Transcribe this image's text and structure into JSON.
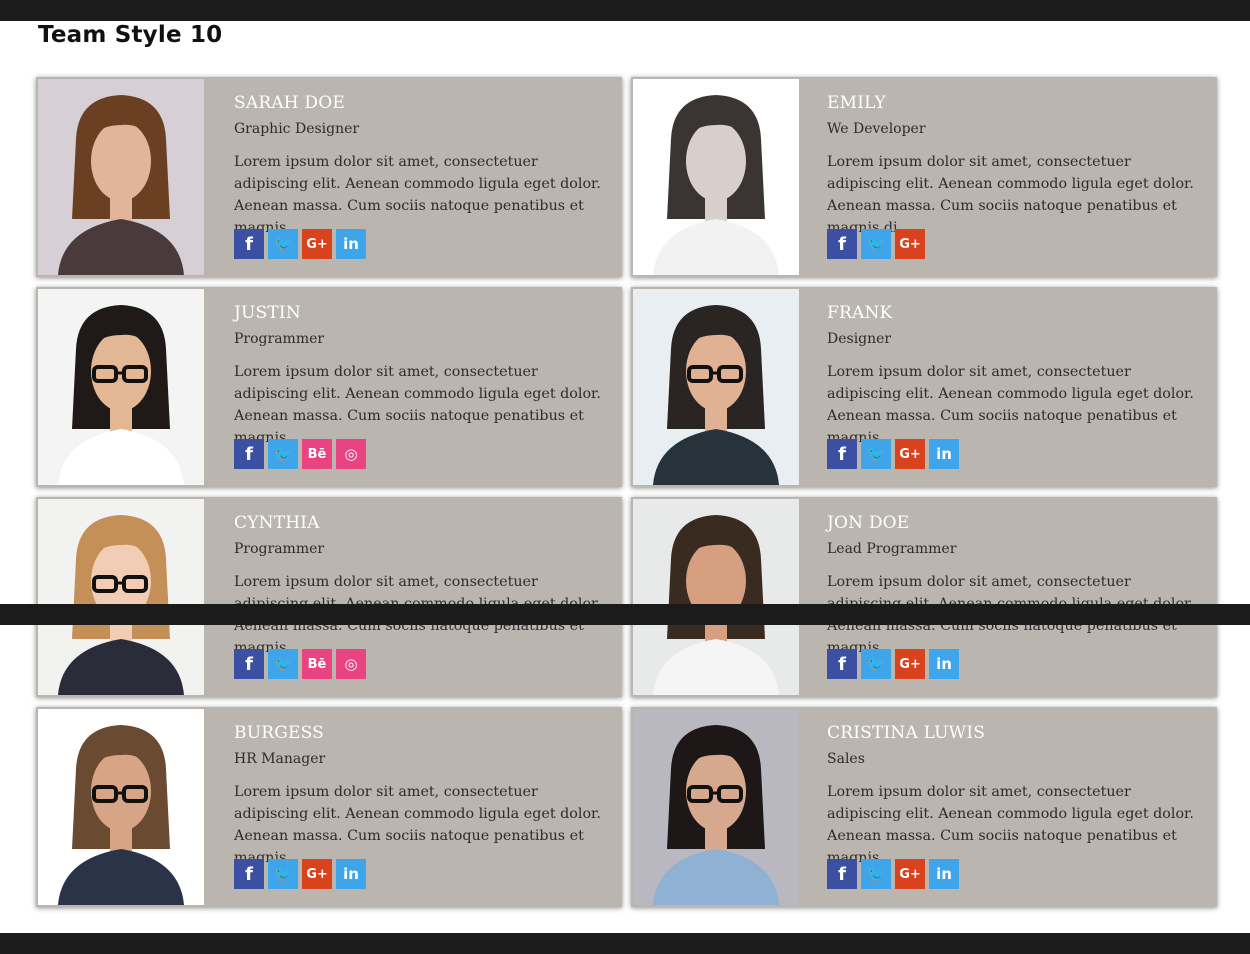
{
  "page_title": "Team Style 10",
  "members": [
    {
      "name": "SARAH DOE",
      "role": "Graphic Designer",
      "bio": "Lorem ipsum dolor sit amet, consectetuer adipiscing elit. Aenean commodo ligula eget dolor. Aenean massa. Cum sociis natoque penatibus et magnis",
      "social": [
        "facebook-icon",
        "twitter-icon",
        "google-plus-icon",
        "linkedin-icon"
      ]
    },
    {
      "name": "EMILY",
      "role": "We Developer",
      "bio": "Lorem ipsum dolor sit amet, consectetuer adipiscing elit. Aenean commodo ligula eget dolor. Aenean massa. Cum sociis natoque penatibus et magnis di",
      "social": [
        "facebook-icon",
        "twitter-icon",
        "google-plus-icon"
      ]
    },
    {
      "name": "JUSTIN",
      "role": "Programmer",
      "bio": "Lorem ipsum dolor sit amet, consectetuer adipiscing elit. Aenean commodo ligula eget dolor. Aenean massa. Cum sociis natoque penatibus et magnis",
      "social": [
        "facebook-icon",
        "twitter-icon",
        "behance-icon",
        "dribbble-icon"
      ]
    },
    {
      "name": "FRANK",
      "role": "Designer",
      "bio": "Lorem ipsum dolor sit amet, consectetuer adipiscing elit. Aenean commodo ligula eget dolor. Aenean massa. Cum sociis natoque penatibus et magnis",
      "social": [
        "facebook-icon",
        "twitter-icon",
        "google-plus-icon",
        "linkedin-icon"
      ]
    },
    {
      "name": "CYNTHIA",
      "role": "Programmer",
      "bio": "Lorem ipsum dolor sit amet, consectetuer adipiscing elit. Aenean commodo ligula eget dolor. Aenean massa. Cum sociis natoque penatibus et magnis",
      "social": [
        "facebook-icon",
        "twitter-icon",
        "behance-icon",
        "dribbble-icon"
      ]
    },
    {
      "name": "JON DOE",
      "role": "Lead Programmer",
      "bio": "Lorem ipsum dolor sit amet, consectetuer adipiscing elit. Aenean commodo ligula eget dolor. Aenean massa. Cum sociis natoque penatibus et magnis",
      "social": [
        "facebook-icon",
        "twitter-icon",
        "google-plus-icon",
        "linkedin-icon"
      ]
    },
    {
      "name": "BURGESS",
      "role": "HR Manager",
      "bio": "Lorem ipsum dolor sit amet, consectetuer adipiscing elit. Aenean commodo ligula eget dolor. Aenean massa. Cum sociis natoque penatibus et magnis",
      "social": [
        "facebook-icon",
        "twitter-icon",
        "google-plus-icon",
        "linkedin-icon"
      ]
    },
    {
      "name": "CRISTINA LUWIS",
      "role": "Sales",
      "bio": "Lorem ipsum dolor sit amet, consectetuer adipiscing elit. Aenean commodo ligula eget dolor. Aenean massa. Cum sociis natoque penatibus et magnis",
      "social": [
        "facebook-icon",
        "twitter-icon",
        "google-plus-icon",
        "linkedin-icon"
      ]
    }
  ],
  "social_glyphs": {
    "facebook-icon": "f",
    "twitter-icon": "🐦",
    "google-plus-icon": "G+",
    "linkedin-icon": "in",
    "behance-icon": "Bē",
    "dribbble-icon": "◎"
  },
  "colors": {
    "card_bg": "#bab5ae",
    "facebook": "#3b4fa3",
    "twitter": "#3fa5ea",
    "google_plus": "#d8431e",
    "linkedin": "#3fa5ea",
    "behance": "#e94382",
    "dribbble": "#e94382"
  }
}
